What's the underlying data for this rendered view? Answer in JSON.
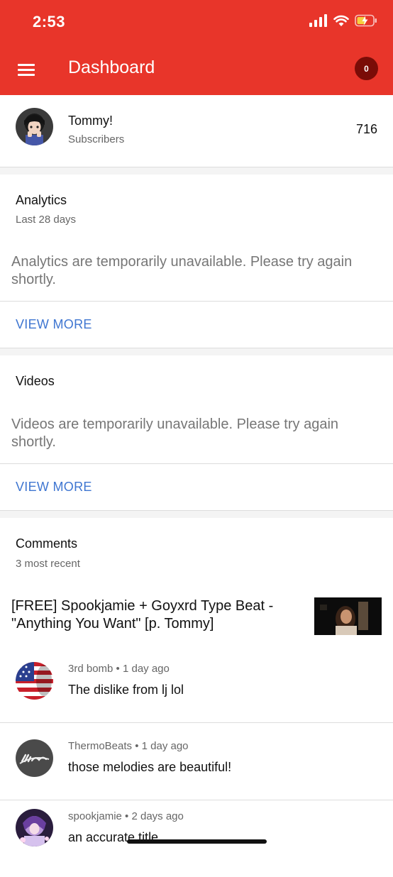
{
  "status_bar": {
    "time": "2:53"
  },
  "app_bar": {
    "title": "Dashboard",
    "notification_count": "0"
  },
  "channel": {
    "name": "Tommy!",
    "subscribers_label": "Subscribers",
    "subscriber_count": "716"
  },
  "analytics": {
    "title": "Analytics",
    "period": "Last 28 days",
    "message": "Analytics are temporarily unavailable. Please try again shortly.",
    "view_more": "VIEW MORE"
  },
  "videos": {
    "title": "Videos",
    "message": "Videos are temporarily unavailable. Please try again shortly.",
    "view_more": "VIEW MORE"
  },
  "comments": {
    "title": "Comments",
    "subtitle": "3 most recent",
    "video_title": "[FREE] Spookjamie + Goyxrd Type Beat - \"Anything You Want\" [p. Tommy]",
    "items": [
      {
        "author": "3rd bomb",
        "time": "1 day ago",
        "text": "The dislike from lj lol"
      },
      {
        "author": "ThermoBeats",
        "time": "1 day ago",
        "text": "those melodies are beautiful!"
      },
      {
        "author": "spookjamie",
        "time": "2 days ago",
        "text": "an accurate title"
      }
    ]
  },
  "colors": {
    "brand_red": "#e8352a",
    "link_blue": "#3f76d1",
    "badge_dark_red": "#7a0c07"
  }
}
